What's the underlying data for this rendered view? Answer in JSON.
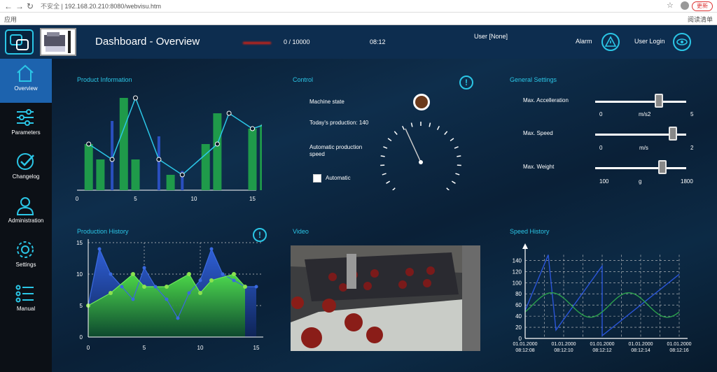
{
  "browser": {
    "insecure_label": "不安全",
    "url": "192.168.20.210:8080/webvisu.htm",
    "bookmark_label": "应用",
    "reading_list_label": "阅读清单",
    "update_label": "更新"
  },
  "header": {
    "title": "Dashboard - Overview",
    "counter": "0 / 10000",
    "time": "08:12",
    "user": "User [None]",
    "alarm_label": "Alarm",
    "login_label": "User Login"
  },
  "sidebar": {
    "items": [
      {
        "label": "Overview",
        "icon": "home-icon"
      },
      {
        "label": "Parameters",
        "icon": "sliders-icon"
      },
      {
        "label": "Changelog",
        "icon": "check-circle-icon"
      },
      {
        "label": "Administration",
        "icon": "user-icon"
      },
      {
        "label": "Settings",
        "icon": "gear-icon"
      },
      {
        "label": "Manual",
        "icon": "list-icon"
      }
    ]
  },
  "product_info": {
    "title": "Product Information",
    "x_ticks": [
      "0",
      "5",
      "10",
      "15"
    ]
  },
  "control": {
    "title": "Control",
    "machine_state_label": "Machine state",
    "production_label": "Today's production: 140",
    "speed_label_line1": "Automatic production",
    "speed_label_line2": "speed",
    "automatic_label": "Automatic",
    "info_symbol": "!"
  },
  "general_settings": {
    "title": "General Settings",
    "accel": {
      "label": "Max. Accelleration",
      "min": "0",
      "unit": "m/s2",
      "max": "5",
      "value_fraction": 0.7
    },
    "speed": {
      "label": "Max. Speed",
      "min": "0",
      "unit": "m/s",
      "max": "2",
      "value_fraction": 0.85
    },
    "weight": {
      "label": "Max. Weight",
      "min": "100",
      "unit": "g",
      "max": "1800",
      "value_fraction": 0.74
    }
  },
  "production_history": {
    "title": "Production History",
    "info_symbol": "!",
    "y_ticks": [
      "15",
      "10",
      "5",
      "0"
    ],
    "x_ticks": [
      "0",
      "5",
      "10",
      "15"
    ]
  },
  "video": {
    "title": "Video"
  },
  "speed_history": {
    "title": "Speed History",
    "y_ticks": [
      "140",
      "120",
      "100",
      "80",
      "60",
      "40",
      "20",
      "0"
    ],
    "x_ticks": [
      {
        "date": "01.01.2000",
        "time": "08:12:08"
      },
      {
        "date": "01.01.2000",
        "time": "08:12:10"
      },
      {
        "date": "01.01.2000",
        "time": "08:12:12"
      },
      {
        "date": "01.01.2000",
        "time": "08:12:14"
      },
      {
        "date": "01.01.2000",
        "time": "08:12:16"
      }
    ]
  },
  "colors": {
    "accent": "#2bc6e6",
    "header": "#0d2d4f",
    "active": "#1d63ae",
    "green": "#1f9a4a",
    "blue": "#2a4fbf"
  },
  "chart_data": [
    {
      "type": "bar",
      "title": "Product Information",
      "x": [
        0,
        15
      ],
      "green_bars": [
        [
          1,
          6
        ],
        [
          2,
          4
        ],
        [
          4,
          12
        ],
        [
          5,
          4
        ],
        [
          8,
          2
        ],
        [
          11,
          6
        ],
        [
          12,
          10
        ],
        [
          15,
          8
        ],
        [
          16,
          8.5
        ]
      ],
      "blue_bars": [
        [
          3,
          9
        ],
        [
          7,
          7
        ],
        [
          9,
          2.5
        ]
      ],
      "line": [
        [
          1,
          6
        ],
        [
          3,
          4
        ],
        [
          5,
          12
        ],
        [
          7,
          4
        ],
        [
          9,
          2
        ],
        [
          12,
          6
        ],
        [
          13,
          10
        ],
        [
          15,
          8
        ],
        [
          16,
          8.5
        ]
      ]
    },
    {
      "type": "area",
      "title": "Production History",
      "x_range": [
        0,
        15
      ],
      "y_range": [
        0,
        15
      ],
      "series": [
        {
          "values": [
            [
              0,
              5
            ],
            [
              1,
              14
            ],
            [
              2,
              10
            ],
            [
              3,
              8
            ],
            [
              4,
              6
            ],
            [
              5,
              11
            ],
            [
              6,
              8
            ],
            [
              7,
              6
            ],
            [
              8,
              3
            ],
            [
              9,
              7
            ],
            [
              10,
              9
            ],
            [
              11,
              14
            ],
            [
              12,
              10
            ],
            [
              13,
              9
            ],
            [
              14,
              8
            ],
            [
              15,
              8
            ]
          ]
        },
        {
          "values": [
            [
              0,
              5
            ],
            [
              2,
              7
            ],
            [
              4,
              10
            ],
            [
              5,
              8
            ],
            [
              7,
              8
            ],
            [
              9,
              10
            ],
            [
              10,
              7
            ],
            [
              11,
              9
            ],
            [
              13,
              10
            ],
            [
              14,
              8
            ]
          ]
        }
      ]
    },
    {
      "type": "line",
      "title": "Speed History",
      "y_range": [
        0,
        150
      ],
      "series": [
        {
          "values": [
            [
              0,
              50
            ],
            [
              0.15,
              150
            ],
            [
              0.2,
              15
            ],
            [
              0.5,
              130
            ],
            [
              0.5,
              5
            ],
            [
              1,
              115
            ]
          ]
        },
        {
          "values": [
            [
              0,
              60
            ],
            [
              0.25,
              80
            ],
            [
              0.45,
              40
            ],
            [
              0.5,
              60
            ],
            [
              0.75,
              80
            ],
            [
              1,
              40
            ]
          ]
        }
      ]
    }
  ]
}
